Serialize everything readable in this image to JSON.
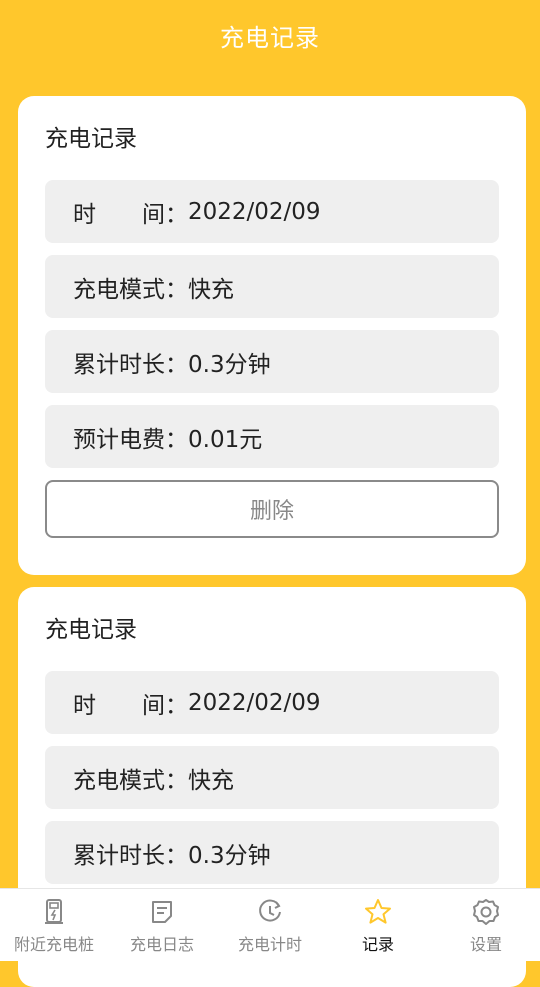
{
  "header": {
    "title": "充电记录"
  },
  "records": [
    {
      "title": "充电记录",
      "time_label": "时　　间：",
      "time_value": "2022/02/09",
      "mode_label": "充电模式：",
      "mode_value": "快充",
      "duration_label": "累计时长：",
      "duration_value": "0.3分钟",
      "fee_label": "预计电费：",
      "fee_value": "0.01元",
      "delete_label": "删除"
    },
    {
      "title": "充电记录",
      "time_label": "时　　间：",
      "time_value": "2022/02/09",
      "mode_label": "充电模式：",
      "mode_value": "快充",
      "duration_label": "累计时长：",
      "duration_value": "0.3分钟"
    }
  ],
  "tabs": [
    {
      "label": "附近充电桩",
      "icon": "charging-pile-icon"
    },
    {
      "label": "充电日志",
      "icon": "log-icon"
    },
    {
      "label": "充电计时",
      "icon": "timer-icon"
    },
    {
      "label": "记录",
      "icon": "star-icon",
      "active": true
    },
    {
      "label": "设置",
      "icon": "gear-icon"
    }
  ],
  "colors": {
    "accent": "#FFC72C",
    "row_bg": "#EFEFEF",
    "tab_inactive": "#888888",
    "star_active": "#FFC72C"
  }
}
